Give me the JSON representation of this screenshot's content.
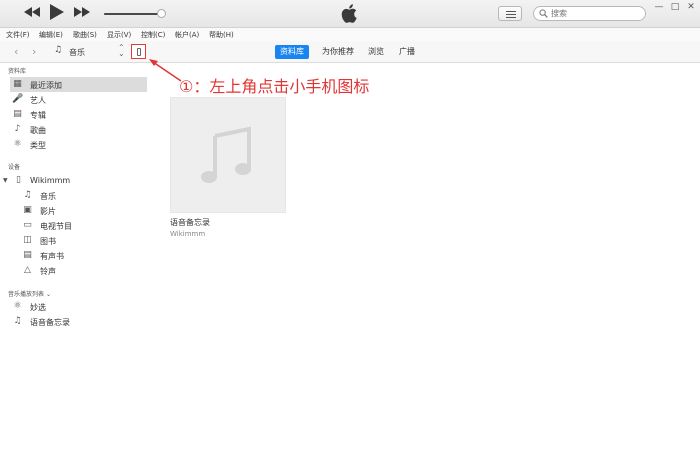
{
  "player": {
    "volume": 0.95,
    "search": {
      "placeholder": "搜索"
    }
  },
  "menu": [
    {
      "label": "文件(F)"
    },
    {
      "label": "编辑(E)"
    },
    {
      "label": "歌曲(S)"
    },
    {
      "label": "显示(V)"
    },
    {
      "label": "控制(C)"
    },
    {
      "label": "帐户(A)"
    },
    {
      "label": "帮助(H)"
    }
  ],
  "nav": {
    "media_kind": "音乐",
    "tabs": [
      {
        "label": "资料库",
        "active": true
      },
      {
        "label": "为你推荐",
        "active": false
      },
      {
        "label": "浏览",
        "active": false
      },
      {
        "label": "广播",
        "active": false
      }
    ]
  },
  "annotation": {
    "text": "①：左上角点击小手机图标",
    "color": "#e23535"
  },
  "sidebar": {
    "library_header": "资料库",
    "library": [
      {
        "label": "最近添加",
        "icon": "recently-added-icon",
        "selected": true
      },
      {
        "label": "艺人",
        "icon": "microphone-icon",
        "selected": false
      },
      {
        "label": "专辑",
        "icon": "album-icon",
        "selected": false
      },
      {
        "label": "歌曲",
        "icon": "music-note-icon",
        "selected": false
      },
      {
        "label": "类型",
        "icon": "genre-icon",
        "selected": false
      }
    ],
    "devices_header": "设备",
    "device_name": "Wikimmm",
    "device_items": [
      {
        "label": "音乐",
        "icon": "music-note-icon"
      },
      {
        "label": "影片",
        "icon": "film-icon"
      },
      {
        "label": "电视节目",
        "icon": "tv-icon"
      },
      {
        "label": "图书",
        "icon": "book-icon"
      },
      {
        "label": "有声书",
        "icon": "audiobook-icon"
      },
      {
        "label": "铃声",
        "icon": "bell-icon"
      }
    ],
    "playlists_header": "音乐播放列表",
    "playlists": [
      {
        "label": "妙选",
        "icon": "genius-icon"
      },
      {
        "label": "语音备忘录",
        "icon": "playlist-icon"
      }
    ]
  },
  "content": {
    "album": {
      "title": "语音备忘录",
      "subtitle": "Wikimmm"
    }
  },
  "colors": {
    "accent": "#1a84f0",
    "highlight_border": "#e23b3b"
  }
}
